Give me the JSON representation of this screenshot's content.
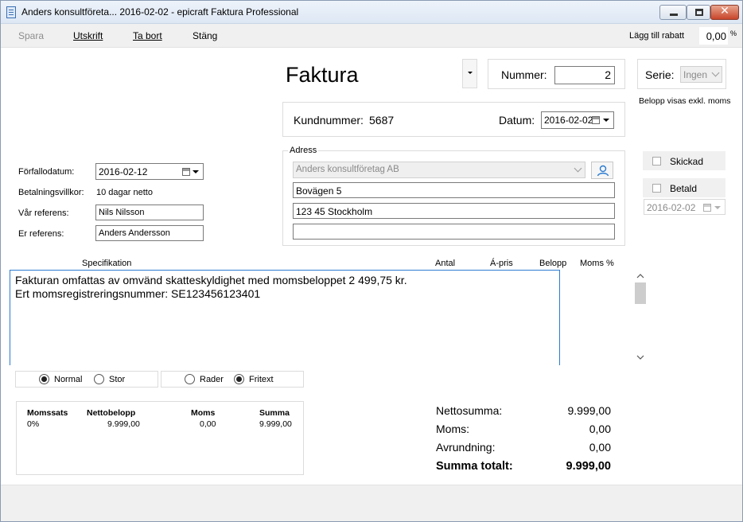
{
  "window": {
    "title": "Anders konsultföreta... 2016-02-02 - epicraft Faktura Professional",
    "minimize": "",
    "maximize": "",
    "close": "✕"
  },
  "toolbar": {
    "spara": "Spara",
    "utskrift": "Utskrift",
    "ta_bort": "Ta bort",
    "stang": "Stäng",
    "rabatt_label": "Lägg till rabatt",
    "rabatt_value": "0,00",
    "rabatt_unit": "%"
  },
  "header": {
    "title": "Faktura",
    "nummer_label": "Nummer:",
    "nummer_value": "2",
    "serie_label": "Serie:",
    "serie_value": "Ingen",
    "belopp_note": "Belopp visas exkl. moms",
    "kundnummer_label": "Kundnummer:",
    "kundnummer_value": "5687",
    "datum_label": "Datum:",
    "datum_value": "2016-02-02"
  },
  "left_fields": {
    "forfallodatum_label": "Förfallodatum:",
    "forfallodatum_value": "2016-02-12",
    "betalningsvillkor_label": "Betalningsvillkor:",
    "betalningsvillkor_value": "10 dagar netto",
    "var_referens_label": "Vår referens:",
    "var_referens_value": "Nils Nilsson",
    "er_referens_label": "Er referens:",
    "er_referens_value": "Anders Andersson"
  },
  "address": {
    "legend": "Adress",
    "customer": "Anders konsultföretag AB",
    "line1": "Bovägen 5",
    "line2": "123 45 Stockholm",
    "line3": ""
  },
  "status": {
    "skickad": "Skickad",
    "betald": "Betald",
    "betald_date": "2016-02-02"
  },
  "spec": {
    "headers": [
      "Specifikation",
      "Antal",
      "Á-pris",
      "Belopp",
      "Moms %"
    ],
    "lines": [
      "Fakturan omfattas av omvänd skatteskyldighet med momsbeloppet 2 499,75 kr.",
      "Ert momsregistreringsnummer: SE123456123401"
    ]
  },
  "view_options": {
    "normal": "Normal",
    "stor": "Stor",
    "rader": "Rader",
    "fritext": "Fritext"
  },
  "vat_table": {
    "headers": [
      "Momssats",
      "Nettobelopp",
      "Moms",
      "Summa"
    ],
    "rows": [
      [
        "0%",
        "9.999,00",
        "0,00",
        "9.999,00"
      ]
    ]
  },
  "totals": {
    "netto_label": "Nettosumma:",
    "netto_value": "9.999,00",
    "moms_label": "Moms:",
    "moms_value": "0,00",
    "avrundning_label": "Avrundning:",
    "avrundning_value": "0,00",
    "summa_label": "Summa totalt:",
    "summa_value": "9.999,00"
  }
}
